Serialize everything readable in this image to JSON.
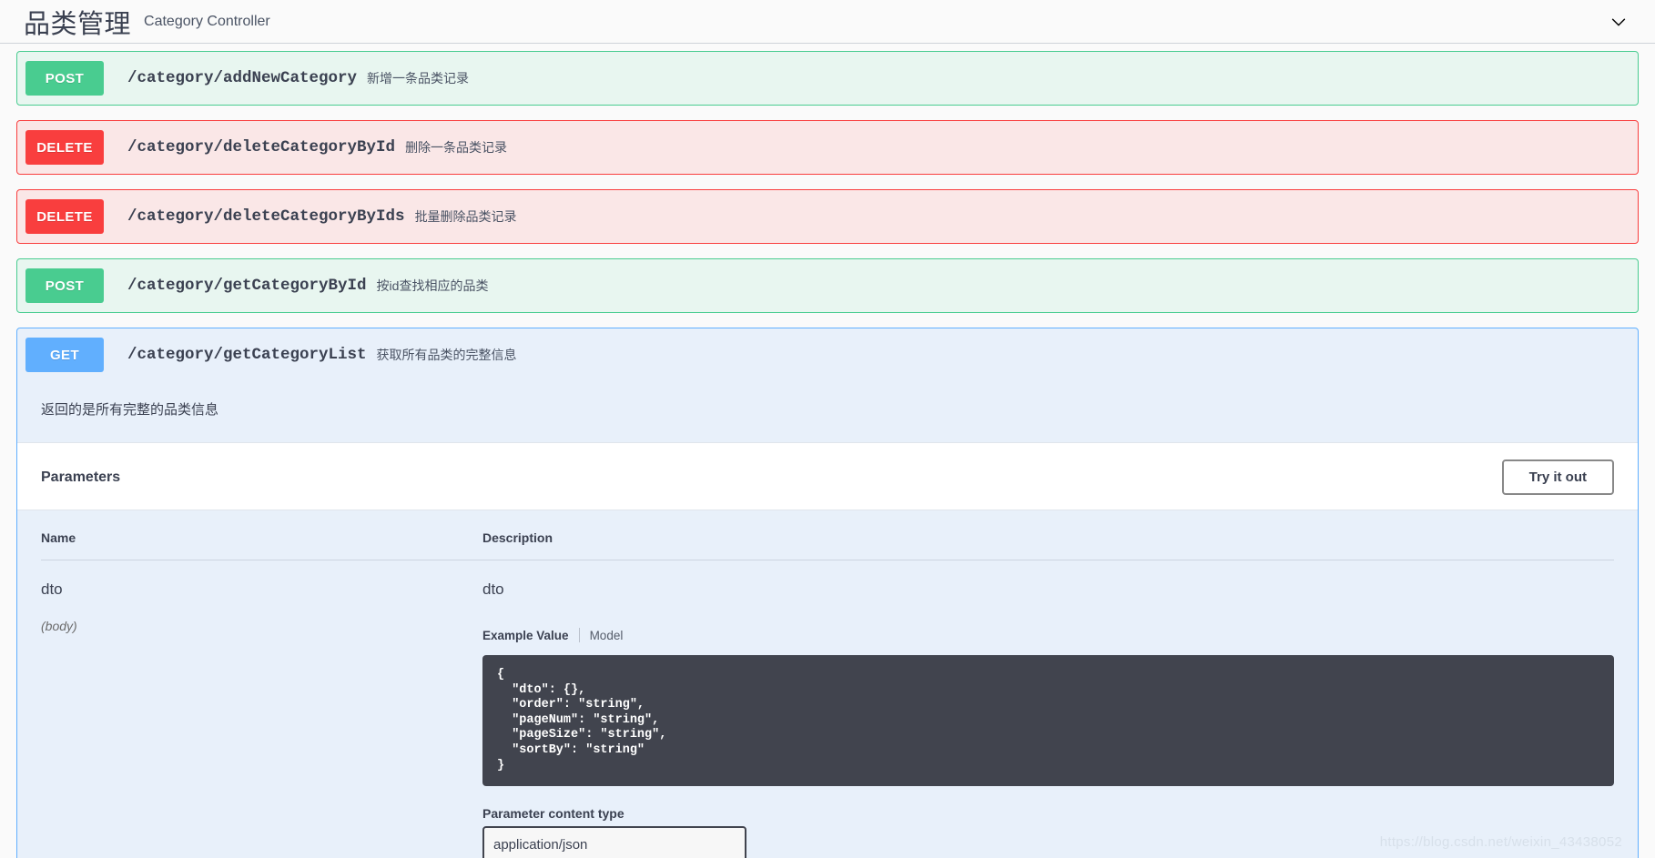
{
  "header": {
    "title": "品类管理",
    "subtitle": "Category Controller",
    "collapse_icon": "chevron-down-icon"
  },
  "operations": [
    {
      "method": "POST",
      "method_key": "post",
      "path": "/category/addNewCategory",
      "description": "新增一条品类记录",
      "expanded": false
    },
    {
      "method": "DELETE",
      "method_key": "delete",
      "path": "/category/deleteCategoryById",
      "description": "删除一条品类记录",
      "expanded": false
    },
    {
      "method": "DELETE",
      "method_key": "delete",
      "path": "/category/deleteCategoryByIds",
      "description": "批量删除品类记录",
      "expanded": false
    },
    {
      "method": "POST",
      "method_key": "post",
      "path": "/category/getCategoryById",
      "description": "按id查找相应的品类",
      "expanded": false
    },
    {
      "method": "GET",
      "method_key": "get",
      "path": "/category/getCategoryList",
      "description": "获取所有品类的完整信息",
      "expanded": true
    }
  ],
  "expanded_operation": {
    "notes": "返回的是所有完整的品类信息",
    "parameters_title": "Parameters",
    "try_it_out_label": "Try it out",
    "table_headers": {
      "name": "Name",
      "description": "Description"
    },
    "parameter_row": {
      "name": "dto",
      "in": "(body)",
      "description": "dto",
      "example_tab_active": "Example Value",
      "example_tab_model": "Model",
      "example_value": "{\n  \"dto\": {},\n  \"order\": \"string\",\n  \"pageNum\": \"string\",\n  \"pageSize\": \"string\",\n  \"sortBy\": \"string\"\n}",
      "content_type_label": "Parameter content type",
      "content_type_value": "application/json"
    }
  },
  "watermark": "https://blog.csdn.net/weixin_43438052",
  "colors": {
    "post": "#49cc90",
    "delete": "#f93e3e",
    "get": "#61affe",
    "code_bg": "#41444e",
    "text": "#3b4151"
  }
}
